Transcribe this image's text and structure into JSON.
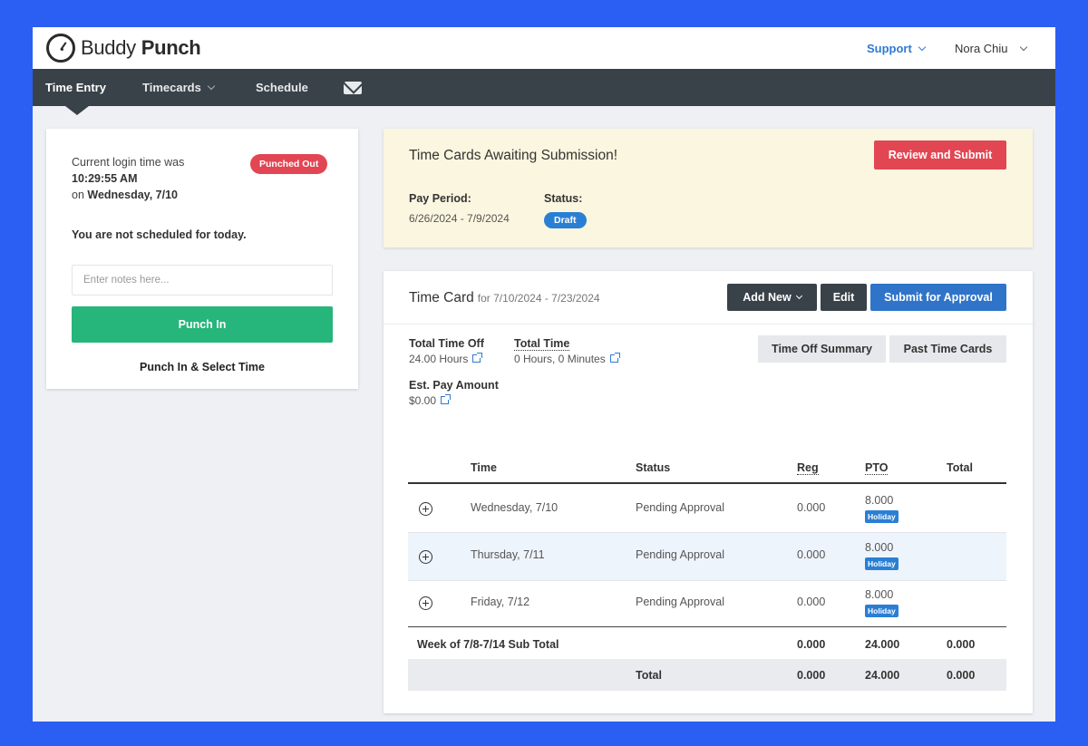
{
  "app": {
    "logo_light": "Buddy",
    "logo_bold": "Punch",
    "support_label": "Support",
    "user_name": "Nora Chiu"
  },
  "nav": {
    "time_entry": "Time Entry",
    "timecards": "Timecards",
    "schedule": "Schedule"
  },
  "punch_panel": {
    "login_label": "Current login time was",
    "login_time": "10:29:55 AM",
    "on_label": "on",
    "login_day": "Wednesday, 7/10",
    "status_badge": "Punched Out",
    "schedule_msg": "You are not scheduled for today.",
    "notes_placeholder": "Enter notes here...",
    "punch_in_label": "Punch In",
    "punch_select_label": "Punch In & Select Time"
  },
  "alert": {
    "title": "Time Cards Awaiting Submission!",
    "review_label": "Review and Submit",
    "pay_period_label": "Pay Period:",
    "pay_period_value": "6/26/2024 - 7/9/2024",
    "status_label": "Status:",
    "status_value": "Draft"
  },
  "timecard": {
    "title": "Time Card",
    "range": "for 7/10/2024 - 7/23/2024",
    "add_new_label": "Add New",
    "edit_label": "Edit",
    "submit_label": "Submit for Approval",
    "time_off_summary_label": "Time Off Summary",
    "past_time_cards_label": "Past Time Cards",
    "total_time_off_label": "Total Time Off",
    "total_time_off_value": "24.00 Hours",
    "total_time_label": "Total Time",
    "total_time_value": "0 Hours, 0 Minutes",
    "est_pay_label": "Est. Pay Amount",
    "est_pay_value": "$0.00",
    "columns": [
      "Time",
      "Status",
      "Reg",
      "PTO",
      "Total"
    ],
    "rows": [
      {
        "day": "Wednesday, 7/10",
        "status": "Pending Approval",
        "reg": "0.000",
        "pto": "8.000",
        "tag": "Holiday"
      },
      {
        "day": "Thursday, 7/11",
        "status": "Pending Approval",
        "reg": "0.000",
        "pto": "8.000",
        "tag": "Holiday"
      },
      {
        "day": "Friday, 7/12",
        "status": "Pending Approval",
        "reg": "0.000",
        "pto": "8.000",
        "tag": "Holiday"
      }
    ],
    "subtotal": {
      "label": "Week of 7/8-7/14 Sub Total",
      "reg": "0.000",
      "pto": "24.000",
      "total": "0.000"
    },
    "grand_total": {
      "label": "Total",
      "reg": "0.000",
      "pto": "24.000",
      "total": "0.000"
    }
  },
  "colors": {
    "frame": "#2b5ef3",
    "nav": "#394249",
    "punched_out": "#e24653",
    "punch_in": "#26b57a",
    "primary": "#2f74c8"
  }
}
